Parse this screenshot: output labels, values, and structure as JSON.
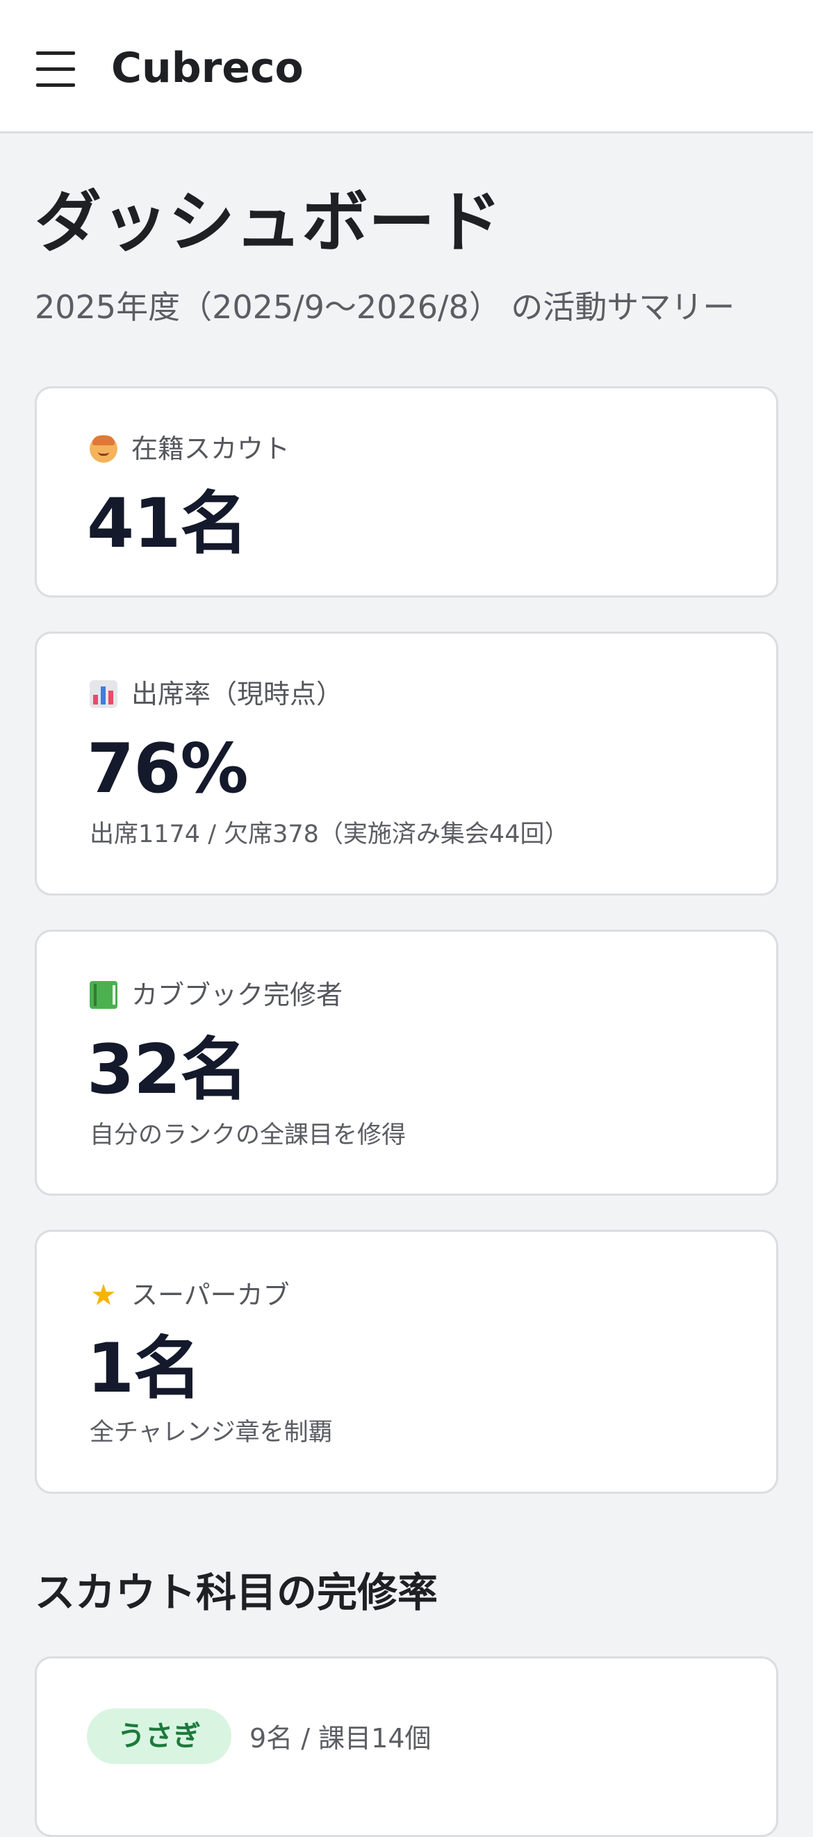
{
  "app": {
    "name": "Cubreco"
  },
  "page": {
    "title": "ダッシュボード",
    "subtitle": "2025年度（2025/9〜2026/8） の活動サマリー"
  },
  "cards": [
    {
      "icon": "scout-face-icon",
      "label": "在籍スカウト",
      "value": "41名",
      "note": ""
    },
    {
      "icon": "bar-chart-icon",
      "label": "出席率（現時点）",
      "value": "76%",
      "note": "出席1174 / 欠席378（実施済み集会44回）"
    },
    {
      "icon": "green-book-icon",
      "label": "カブブック完修者",
      "value": "32名",
      "note": "自分のランクの全課目を修得"
    },
    {
      "icon": "star-icon",
      "label": "スーパーカブ",
      "value": "1名",
      "note": "全チャレンジ章を制覇"
    }
  ],
  "section": {
    "title": "スカウト科目の完修率",
    "ranks": [
      {
        "badge": "うさぎ",
        "meta": "9名 / 課目14個"
      }
    ]
  },
  "colors": {
    "background": "#f2f3f5",
    "card_bg": "#ffffff",
    "value_text": "#141a2b",
    "badge_bg": "#d9f5e1",
    "badge_text": "#1c7a3c"
  }
}
